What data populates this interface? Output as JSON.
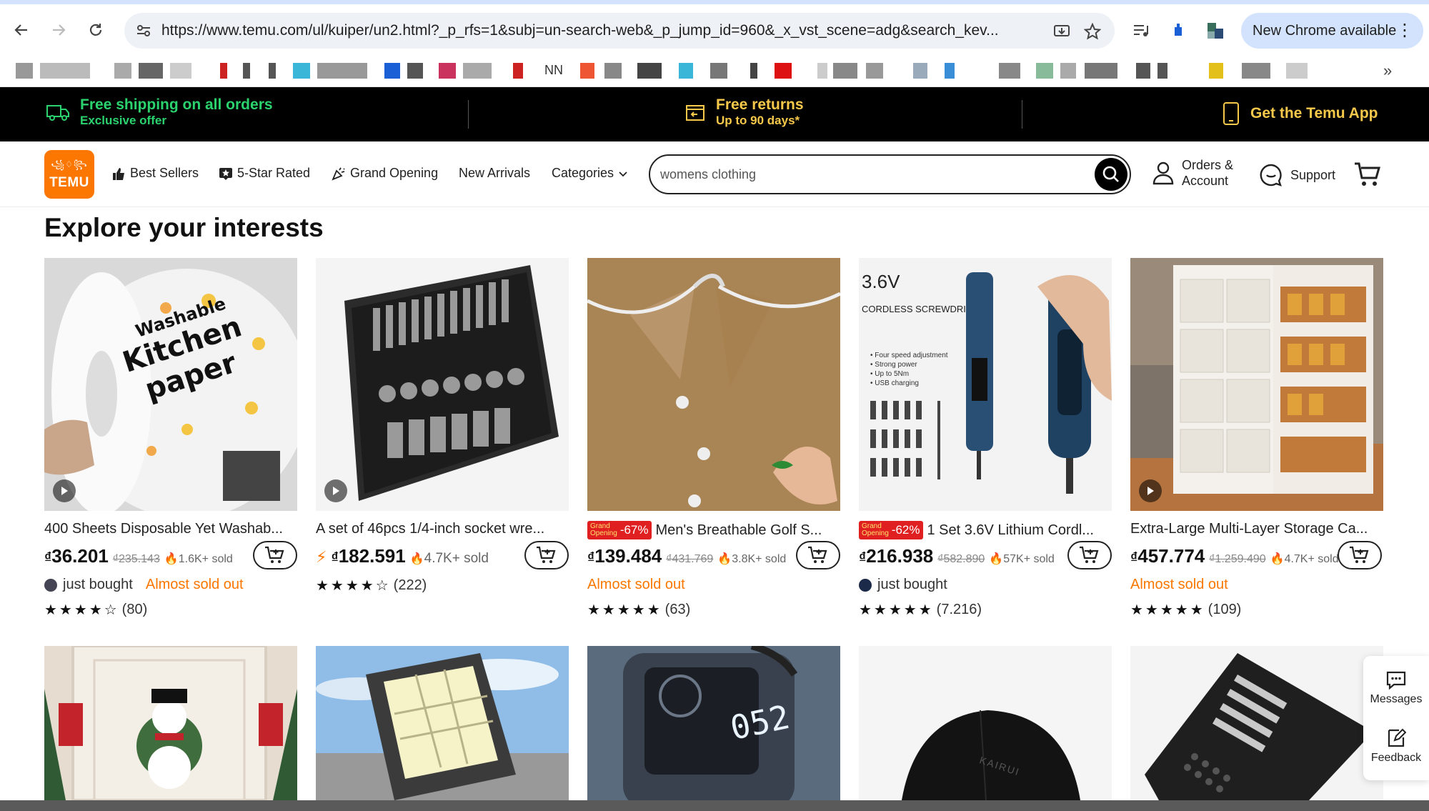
{
  "browser": {
    "url": "https://www.temu.com/ul/kuiper/un2.html?_p_rfs=1&subj=un-search-web&_p_jump_id=960&_x_vst_scene=adg&search_kev...",
    "update_label": "New Chrome available",
    "bookmark_text": "NN"
  },
  "promo": {
    "shipping_title": "Free shipping on all orders",
    "shipping_sub": "Exclusive offer",
    "returns_title": "Free returns",
    "returns_sub": "Up to 90 days*",
    "app_label": "Get the Temu App"
  },
  "header": {
    "logo_glyphs": "꧁♢꧂",
    "logo_text": "TEMU",
    "nav": {
      "best_sellers": "Best Sellers",
      "five_star": "5-Star Rated",
      "grand_opening": "Grand Opening",
      "new_arrivals": "New Arrivals",
      "categories": "Categories"
    },
    "search_value": "womens clothing",
    "orders_line1": "Orders &",
    "orders_line2": "Account",
    "support": "Support"
  },
  "section_title": "Explore your interests",
  "products": [
    {
      "title": "400 Sheets Disposable Yet Washab...",
      "currency": "₫",
      "price": "36.201",
      "old_price": "₫235.143",
      "sold": "1.6K+ sold",
      "just_bought": "just bought",
      "status": "Almost sold out",
      "stars": "★★★★☆",
      "reviews": "(80)",
      "img_text1": "Washable",
      "img_text2": "Kitchen",
      "img_text3": "paper"
    },
    {
      "title": "A set of 46pcs 1/4-inch socket wre...",
      "currency": "₫",
      "price": "182.591",
      "sold": "4.7K+ sold",
      "stars": "★★★★☆",
      "reviews": "(222)"
    },
    {
      "badge_top": "Grand",
      "badge_bottom": "Opening",
      "badge_pct": "-67%",
      "title": "Men's Breathable Golf S...",
      "currency": "₫",
      "price": "139.484",
      "old_price": "₫431.769",
      "sold": "3.8K+ sold",
      "status": "Almost sold out",
      "stars": "★★★★★",
      "reviews": "(63)"
    },
    {
      "badge_top": "Grand",
      "badge_bottom": "Opening",
      "badge_pct": "-62%",
      "title": "1 Set 3.6V Lithium Cordl...",
      "currency": "₫",
      "price": "216.938",
      "old_price": "₫582.890",
      "sold": "57K+ sold",
      "just_bought": "just bought",
      "stars": "★★★★★",
      "reviews": "(7.216)",
      "img_text1": "3.6V",
      "img_text2": "CORDLESS SCREWDRIVER",
      "img_bullets": "• Four speed adjustment\n• Strong power\n• Up to 5Nm\n• USB charging"
    },
    {
      "title": "Extra-Large Multi-Layer Storage Ca...",
      "currency": "₫",
      "price": "457.774",
      "old_price": "₫1.259.490",
      "sold": "4.7K+ sold",
      "status": "Almost sold out",
      "stars": "★★★★★",
      "reviews": "(109)"
    }
  ],
  "row2_img_text": "052",
  "row2_cap_text": "KAIRUI",
  "side": {
    "messages": "Messages",
    "feedback": "Feedback"
  }
}
